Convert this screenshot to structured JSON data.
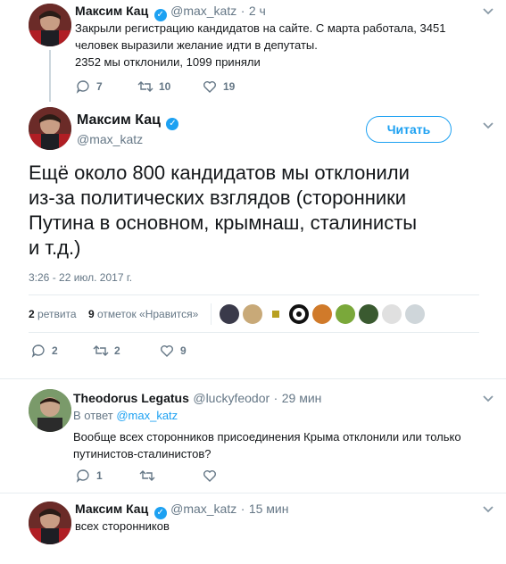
{
  "tweet1": {
    "name": "Максим Кац",
    "handle": "@max_katz",
    "time": "2 ч",
    "text_line1": "Закрыли регистрацию кандидатов на сайте. С марта работала, 3451",
    "text_line2": "человек выразили желание идти в депутаты.",
    "text_line3": "2352 мы отклонили, 1099 приняли",
    "replies": "7",
    "retweets": "10",
    "likes": "19"
  },
  "main": {
    "name": "Максим Кац",
    "handle": "@max_katz",
    "follow_label": "Читать",
    "text_line1": "Ещё около 800 кандидатов мы отклонили",
    "text_line2": "из-за политических взглядов (сторонники",
    "text_line3": "Путина в основном, крымнаш, сталинисты",
    "text_line4": "и т.д.)",
    "timestamp": "3:26 - 22 июл. 2017 г.",
    "retweets_count": "2",
    "retweets_label": "ретвита",
    "likes_count": "9",
    "likes_label": "отметок «Нравится»",
    "replies": "2",
    "retweets": "2",
    "likes": "9"
  },
  "reply1": {
    "name": "Theodorus Legatus",
    "handle": "@luckyfeodor",
    "time": "29 мин",
    "in_reply_prefix": "В ответ",
    "in_reply_handle": "@max_katz",
    "text_line1": "Вообще всех сторонников присоединения Крыма отклонили или только",
    "text_line2": "путинистов-сталинистов?",
    "replies": "1"
  },
  "reply2": {
    "name": "Максим Кац",
    "handle": "@max_katz",
    "time": "15 мин",
    "text": "всех сторонников"
  },
  "colors": {
    "accent": "#1da1f2",
    "muted": "#657786",
    "text": "#14171a",
    "divider": "#e6ecf0"
  },
  "icons": {
    "reply": "reply-icon",
    "retweet": "retweet-icon",
    "like": "heart-icon",
    "more": "chevron-down-icon",
    "verified": "verified-badge-icon"
  }
}
